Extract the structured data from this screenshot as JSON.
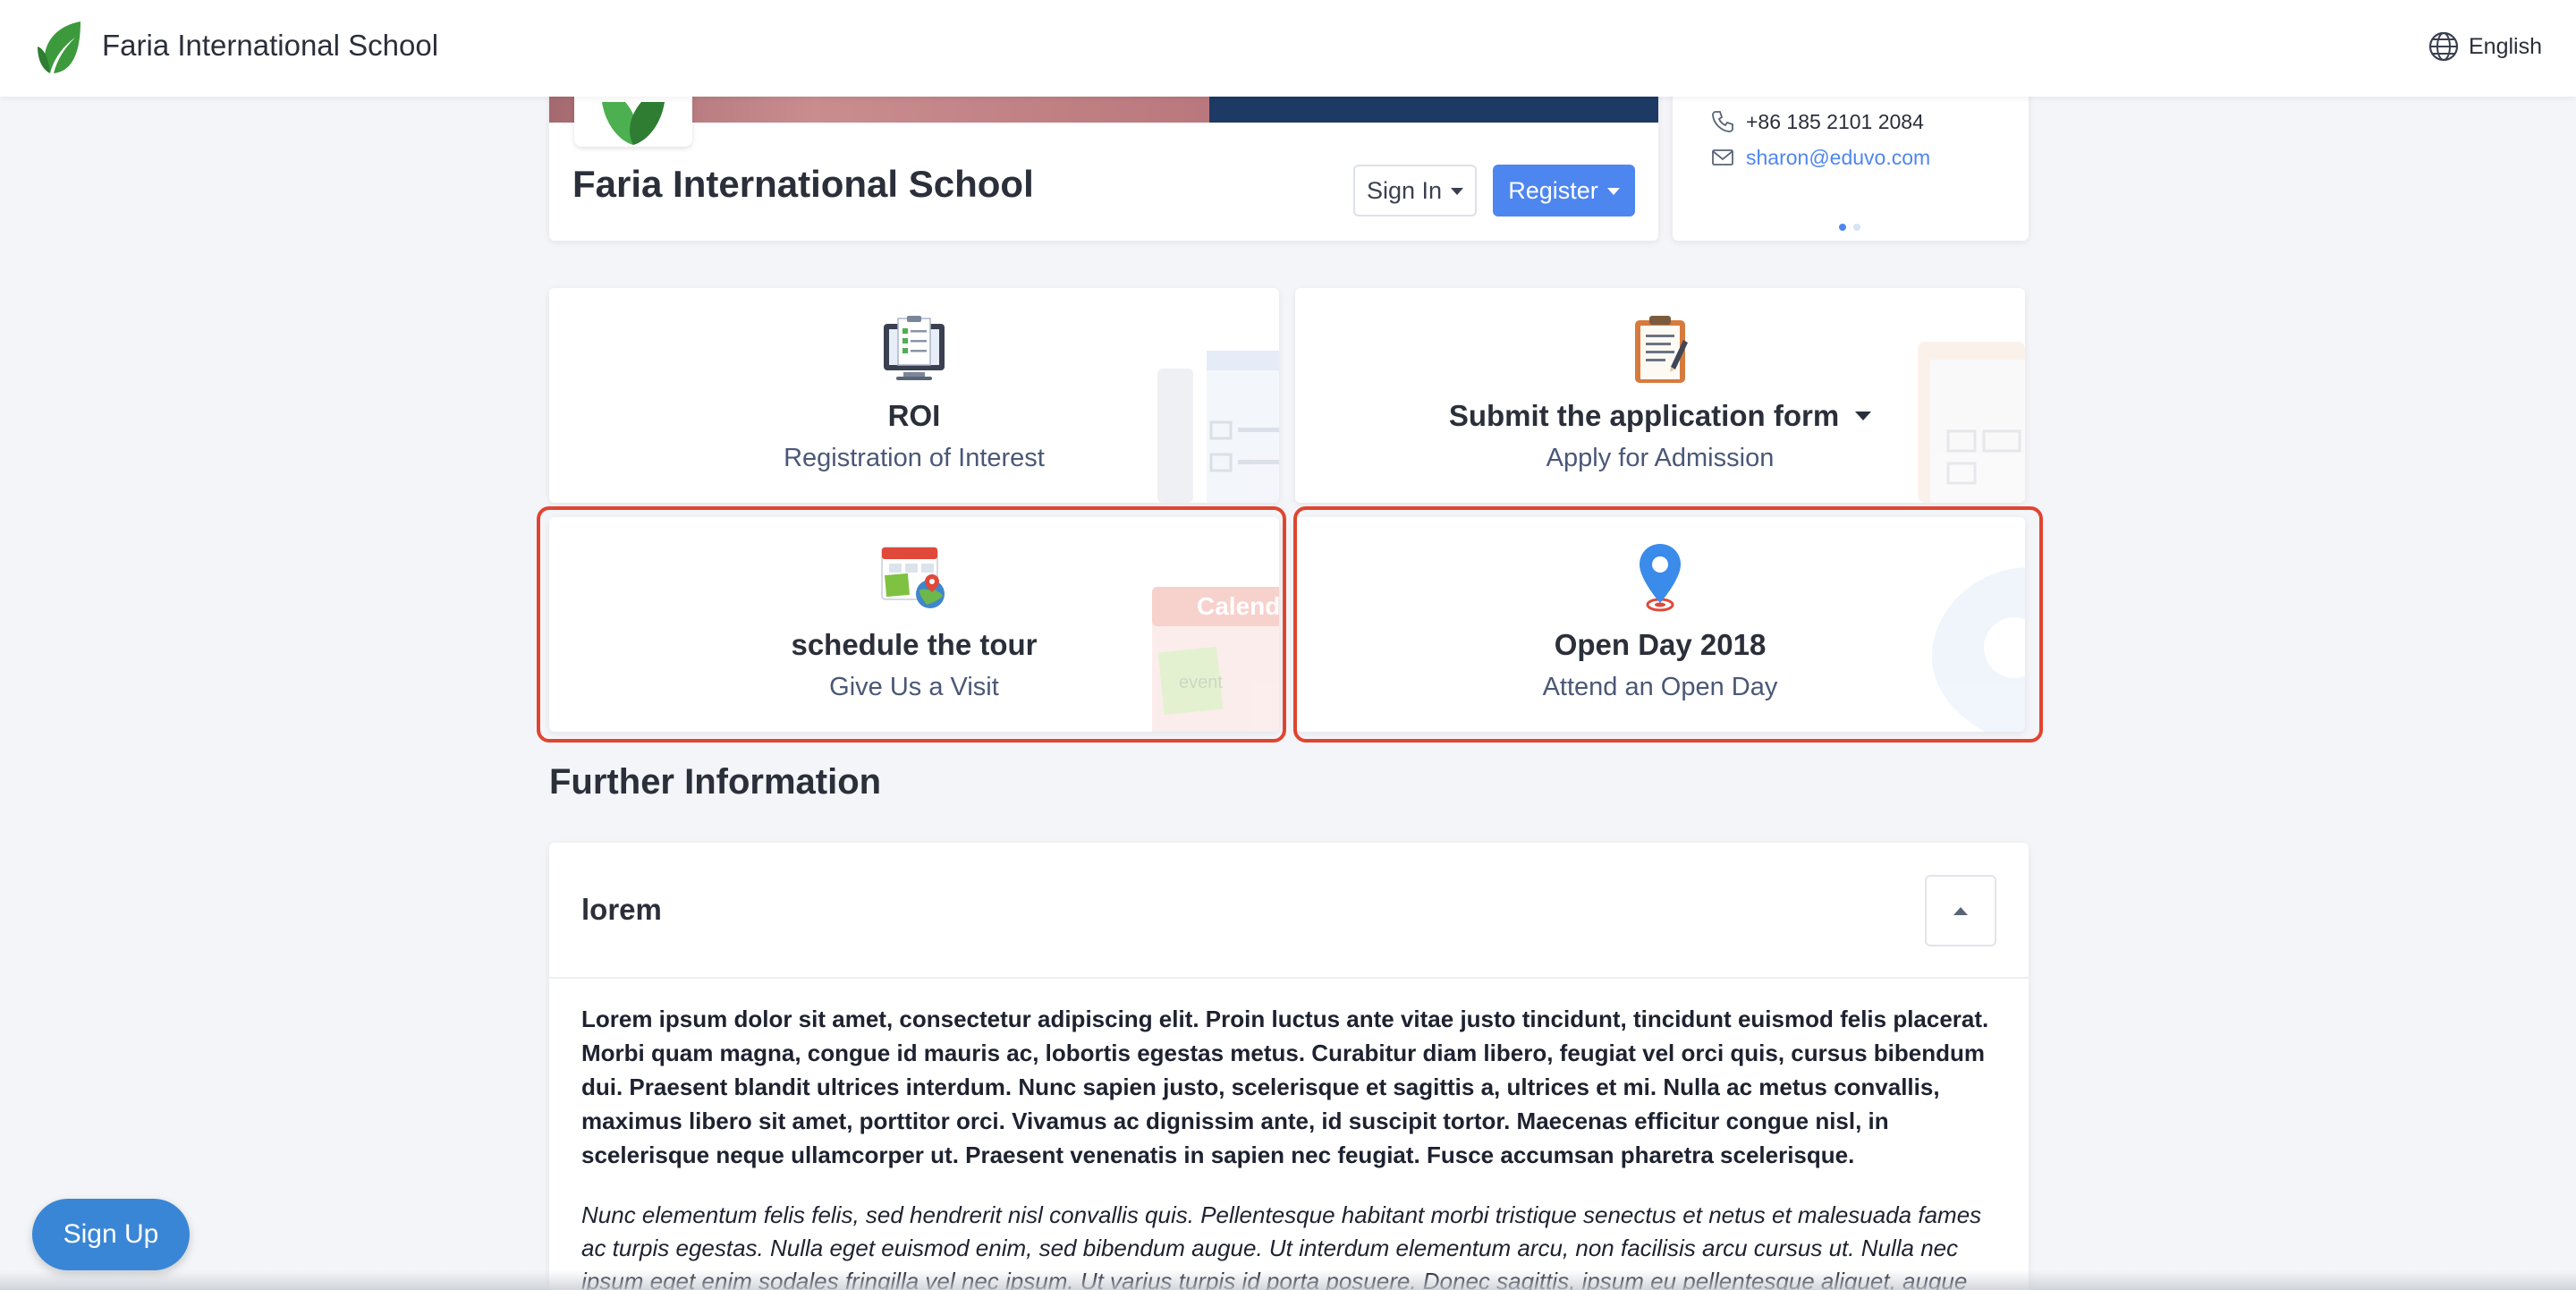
{
  "header": {
    "brand": "Faria International School",
    "language": "English"
  },
  "school": {
    "name": "Faria International School",
    "sign_in_label": "Sign In",
    "register_label": "Register"
  },
  "contact": {
    "phone": "+86 185 2101 2084",
    "email": "sharon@eduvo.com"
  },
  "tiles": {
    "roi": {
      "title": "ROI",
      "subtitle": "Registration of Interest",
      "icon": "checklist-computer-icon"
    },
    "apply": {
      "title": "Submit the application form",
      "subtitle": "Apply for Admission",
      "icon": "clipboard-icon"
    },
    "tour": {
      "title": "schedule the tour",
      "subtitle": "Give Us a Visit",
      "icon": "calendar-globe-icon",
      "watermark": "Calendar",
      "watermark_note": "event"
    },
    "openday": {
      "title": "Open Day 2018",
      "subtitle": "Attend an Open Day",
      "icon": "map-pin-icon"
    }
  },
  "further_info": {
    "heading": "Further Information",
    "accordion_title": "lorem",
    "paragraph_bold": "Lorem ipsum dolor sit amet, consectetur adipiscing elit. Proin luctus ante vitae justo tincidunt, tincidunt euismod felis placerat. Morbi quam magna, congue id mauris ac, lobortis egestas metus. Curabitur diam libero, feugiat vel orci quis, cursus bibendum dui. Praesent blandit ultrices interdum. Nunc sapien justo, scelerisque et sagittis a, ultrices et mi. Nulla ac metus convallis, maximus libero sit amet, porttitor orci. Vivamus ac dignissim ante, id suscipit tortor. Maecenas efficitur congue nisl, in scelerisque neque ullamcorper ut. Praesent venenatis in sapien nec feugiat. Fusce accumsan pharetra scelerisque.",
    "paragraph_italic": "Nunc elementum felis felis, sed hendrerit nisl convallis quis. Pellentesque habitant morbi tristique senectus et netus et malesuada fames ac turpis egestas. Nulla eget euismod enim, sed bibendum augue. Ut interdum elementum arcu, non facilisis arcu cursus ut. Nulla nec ipsum eget enim sodales fringilla vel nec ipsum. Ut varius turpis id porta posuere. Donec sagittis, ipsum eu pellentesque aliquet, augue quam"
  },
  "signup_label": "Sign Up",
  "colors": {
    "accent": "#4e86ef",
    "highlight": "#e04530",
    "signup": "#3a86d6",
    "banner_navy": "#1c3a63"
  }
}
